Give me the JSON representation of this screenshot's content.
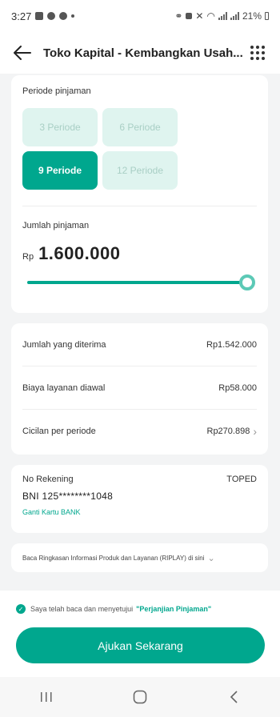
{
  "status_bar": {
    "time": "3:27",
    "battery": "21%"
  },
  "header": {
    "title": "Toko Kapital - Kembangkan Usah..."
  },
  "loan": {
    "period_label": "Periode pinjaman",
    "periods": [
      {
        "label": "3 Periode",
        "selected": false
      },
      {
        "label": "6 Periode",
        "selected": false
      },
      {
        "label": "9 Periode",
        "selected": true
      },
      {
        "label": "12 Periode",
        "selected": false
      }
    ],
    "amount_label": "Jumlah pinjaman",
    "currency": "Rp",
    "amount": "1.600.000",
    "slider_fraction": 1.0
  },
  "summary": {
    "rows": [
      {
        "label": "Jumlah yang diterima",
        "value": "Rp1.542.000"
      },
      {
        "label": "Biaya layanan diawal",
        "value": "Rp58.000"
      },
      {
        "label": "Cicilan per periode",
        "value": "Rp270.898"
      }
    ]
  },
  "account": {
    "label": "No Rekening",
    "tag": "TOPED",
    "number": "BNI 125********1048",
    "change_link": "Ganti Kartu BANK"
  },
  "riplay": {
    "text": "Baca Ringkasan Informasi Produk dan Layanan (RIPLAY) di sini"
  },
  "footer": {
    "agree_text": "Saya telah baca dan menyetujui",
    "agree_link": "\"Perjanjian Pinjaman\"",
    "submit_label": "Ajukan Sekarang"
  },
  "colors": {
    "accent": "#00a78e",
    "accent_light": "#dff4ef"
  }
}
